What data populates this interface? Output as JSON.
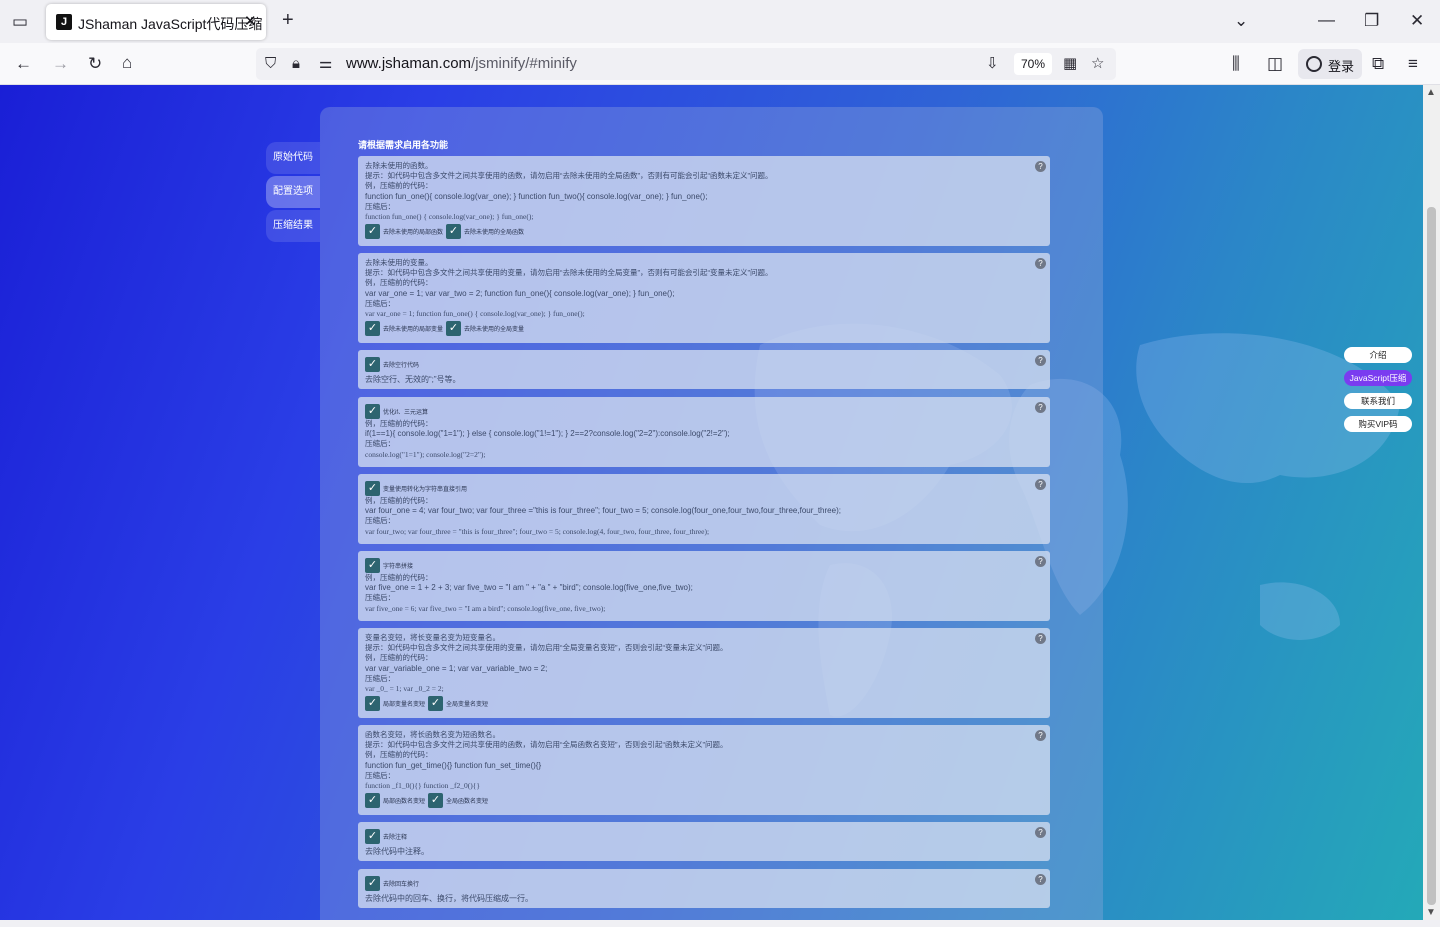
{
  "browser": {
    "tab_title": "JShaman JavaScript代码压缩",
    "tab_close": "✕",
    "new_tab": "+",
    "url_domain": "www.jshaman.com",
    "url_path": "/jsminify/#minify",
    "zoom": "70%",
    "login_label": "登录"
  },
  "page": {
    "heading": "请根据需求启用各功能",
    "sidenav": [
      "原始代码",
      "配置选项",
      "压缩结果"
    ],
    "sidenav_active": 1,
    "rightnav": [
      "介绍",
      "JavaScript压缩",
      "联系我们",
      "购买VIP码"
    ],
    "rightnav_active": 1,
    "cards": [
      {
        "lines": [
          "去除未使用的函数。",
          "提示：如代码中包含多文件之间共享使用的函数，请勿启用“去除未使用的全局函数”，否则有可能会引起“函数未定义”问题。",
          "例，压缩前的代码：",
          "function fun_one(){ console.log(var_one); } function fun_two(){ console.log(var_one); } fun_one();",
          "压缩后：",
          "function fun_one() { console.log(var_one); } fun_one();"
        ],
        "checks": [
          "去除未使用的局部函数",
          "去除未使用的全局函数"
        ]
      },
      {
        "lines": [
          "去除未使用的变量。",
          "提示：如代码中包含多文件之间共享使用的变量，请勿启用“去除未使用的全局变量”，否则有可能会引起“变量未定义”问题。",
          "例，压缩前的代码：",
          "var var_one = 1; var var_two = 2; function fun_one(){ console.log(var_one); } fun_one();",
          "压缩后：",
          "var var_one = 1; function fun_one() { console.log(var_one); } fun_one();"
        ],
        "checks": [
          "去除未使用的局部变量",
          "去除未使用的全局变量"
        ]
      },
      {
        "title": "去除空行代码",
        "desc": "去除空行、无效的“;”号等。"
      },
      {
        "title": "优化if、三元运算",
        "lines": [
          "例，压缩前的代码：",
          "if(1==1){ console.log(\"1=1\"); } else { console.log(\"1!=1\"); } 2==2?console.log(\"2=2\"):console.log(\"2!=2\");",
          "压缩后：",
          "console.log(\"1=1\"); console.log(\"2=2\");"
        ]
      },
      {
        "title": "变量使用转化为字符串直接引用",
        "lines": [
          "例，压缩前的代码：",
          "var four_one = 4; var four_two; var four_three =\"this is four_three\"; four_two = 5; console.log(four_one,four_two,four_three,four_three);",
          "压缩后：",
          "var four_two; var four_three = \"this is four_three\"; four_two = 5; console.log(4, four_two, four_three, four_three);"
        ]
      },
      {
        "title": "字符串拼接",
        "lines": [
          "例，压缩前的代码：",
          "var five_one = 1 + 2 + 3; var five_two = \"I am \" + \"a \" + \"bird\"; console.log(five_one,five_two);",
          "压缩后：",
          "var five_one = 6; var five_two = \"I am a bird\"; console.log(five_one, five_two);"
        ]
      },
      {
        "lines": [
          "变量名变短，将长变量名变为短变量名。",
          "提示：如代码中包含多文件之间共享使用的变量，请勿启用“全局变量名变短”，否则会引起“变量未定义”问题。",
          "例，压缩前的代码：",
          "var var_variable_one = 1; var var_variable_two = 2;",
          "压缩后：",
          "var _0_ = 1; var _0_2 = 2;"
        ],
        "checks": [
          "局部变量名变短",
          "全局变量名变短"
        ]
      },
      {
        "lines": [
          "函数名变短，将长函数名变为短函数名。",
          "提示：如代码中包含多文件之间共享使用的函数，请勿启用“全局函数名变短”，否则会引起“函数未定义”问题。",
          "例，压缩前的代码：",
          "function fun_get_time(){} function fun_set_time(){}",
          "压缩后：",
          "function _f1_0(){} function _f2_0(){}"
        ],
        "checks": [
          "局部函数名变短",
          "全局函数名变短"
        ]
      },
      {
        "title": "去除注释",
        "desc": "去除代码中注释。"
      },
      {
        "title": "去除回车换行",
        "desc": "去除代码中的回车、换行，将代码压缩成一行。"
      }
    ]
  },
  "icons": {
    "check": "✓",
    "help": "?"
  }
}
